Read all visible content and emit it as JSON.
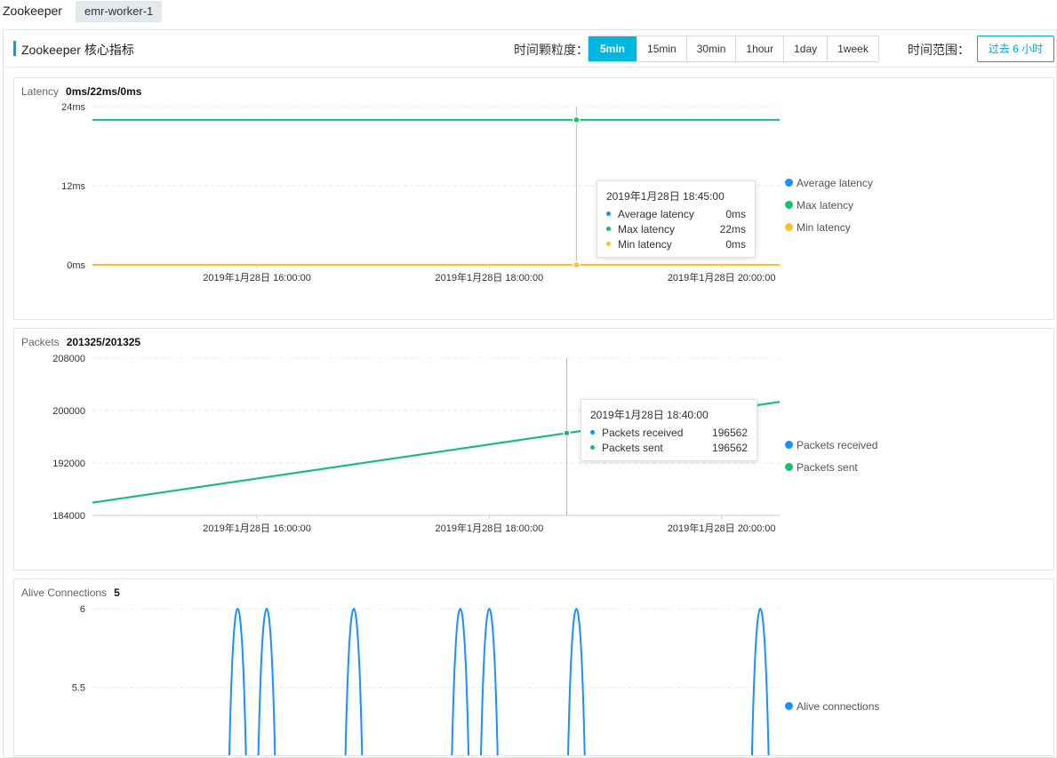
{
  "header": {
    "app_title": "Zookeeper",
    "node_tag": "emr-worker-1"
  },
  "section": {
    "title": "Zookeeper 核心指标",
    "granularity_label": "时间颗粒度：",
    "granularity_options": [
      "5min",
      "15min",
      "30min",
      "1hour",
      "1day",
      "1week"
    ],
    "granularity_selected": "5min",
    "range_label": "时间范围：",
    "range_value": "过去 6 小时"
  },
  "colors": {
    "accent": "#00b7e0",
    "blue": "#1890ff",
    "green": "#13c26b",
    "yellow": "#fcc02e"
  },
  "panels": {
    "latency": {
      "name": "Latency",
      "value": "0ms/22ms/0ms",
      "legend": [
        "Average latency",
        "Max latency",
        "Min latency"
      ],
      "tooltip": {
        "title": "2019年1月28日 18:45:00",
        "rows": [
          {
            "name": "Average latency",
            "value": "0ms"
          },
          {
            "name": "Max latency",
            "value": "22ms"
          },
          {
            "name": "Min latency",
            "value": "0ms"
          }
        ]
      }
    },
    "packets": {
      "name": "Packets",
      "value": "201325/201325",
      "legend": [
        "Packets received",
        "Packets sent"
      ],
      "tooltip": {
        "title": "2019年1月28日 18:40:00",
        "rows": [
          {
            "name": "Packets received",
            "value": "196562"
          },
          {
            "name": "Packets sent",
            "value": "196562"
          }
        ]
      }
    },
    "connections": {
      "name": "Alive Connections",
      "value": "5",
      "legend": [
        "Alive connections"
      ]
    }
  },
  "chart_data": [
    {
      "type": "line",
      "x_ticks": [
        "2019年1月28日 16:00:00",
        "2019年1月28日 18:00:00",
        "2019年1月28日 20:00:00"
      ],
      "y_ticks": [
        "0ms",
        "12ms",
        "24ms"
      ],
      "ylim": [
        0,
        24
      ],
      "xlim": [
        "2019-01-28 14:35",
        "2019-01-28 20:30"
      ],
      "grid": true,
      "legend_position": "right",
      "series": [
        {
          "name": "Average latency",
          "color": "#1890ff",
          "x": [
            "2019-01-28 14:35",
            "2019-01-28 20:30"
          ],
          "values": [
            0,
            0
          ]
        },
        {
          "name": "Max latency",
          "color": "#13c26b",
          "x": [
            "2019-01-28 14:35",
            "2019-01-28 20:30"
          ],
          "values": [
            22,
            22
          ]
        },
        {
          "name": "Min latency",
          "color": "#fcc02e",
          "x": [
            "2019-01-28 14:35",
            "2019-01-28 20:30"
          ],
          "values": [
            0,
            0
          ]
        }
      ],
      "highlight": {
        "x": "2019-01-28 18:45",
        "values": [
          0,
          22,
          0
        ]
      }
    },
    {
      "type": "line",
      "x_ticks": [
        "2019年1月28日 16:00:00",
        "2019年1月28日 18:00:00",
        "2019年1月28日 20:00:00"
      ],
      "y_ticks": [
        "184000",
        "192000",
        "200000",
        "208000"
      ],
      "ylim": [
        184000,
        208000
      ],
      "xlim": [
        "2019-01-28 14:35",
        "2019-01-28 20:30"
      ],
      "grid": true,
      "legend_position": "right",
      "series": [
        {
          "name": "Packets received",
          "color": "#1890ff",
          "x": [
            "2019-01-28 14:35",
            "2019-01-28 20:30"
          ],
          "values": [
            185950,
            201325
          ]
        },
        {
          "name": "Packets sent",
          "color": "#13c26b",
          "x": [
            "2019-01-28 14:35",
            "2019-01-28 20:30"
          ],
          "values": [
            185950,
            201325
          ]
        }
      ],
      "highlight": {
        "x": "2019-01-28 18:40",
        "values": [
          196562,
          196562
        ]
      }
    },
    {
      "type": "line",
      "y_ticks": [
        "5.5",
        "6"
      ],
      "ylim": [
        5,
        6
      ],
      "grid": true,
      "legend_position": "right",
      "series": [
        {
          "name": "Alive connections",
          "color": "#1890ff",
          "baseline": 5,
          "spikes_at": [
            "2019-01-28 15:50",
            "2019-01-28 16:05",
            "2019-01-28 16:50",
            "2019-01-28 17:45",
            "2019-01-28 18:00",
            "2019-01-28 18:45",
            "2019-01-28 20:20"
          ],
          "spike_value": 6
        }
      ]
    }
  ]
}
